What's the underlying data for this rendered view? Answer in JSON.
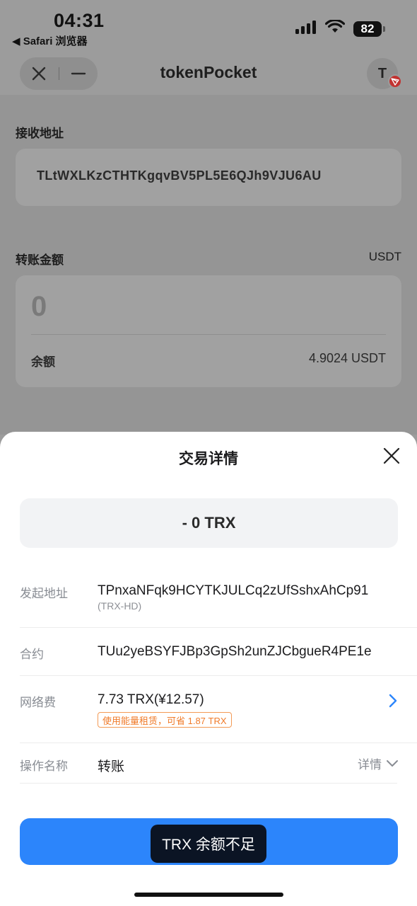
{
  "status_bar": {
    "time": "04:31",
    "back_app": "◀ Safari 浏览器",
    "battery": "82"
  },
  "nav": {
    "title": "tokenPocket",
    "avatar_letter": "T"
  },
  "form": {
    "receive_label": "接收地址",
    "receive_address": "TLtWXLKzCTHTKgqvBV5PL5E6QJh9VJU6AU",
    "amount_label": "转账金额",
    "amount_unit": "USDT",
    "amount_value": "0",
    "balance_label": "余额",
    "balance_value": "4.9024 USDT"
  },
  "sheet": {
    "title": "交易详情",
    "amount": "- 0 TRX",
    "from_label": "发起地址",
    "from_address": "TPnxaNFqk9HCYTKJULCq2zUfSshxAhCp91",
    "from_sub": "(TRX-HD)",
    "contract_label": "合约",
    "contract_address": "TUu2yeBSYFJBp3GpSh2unZJCbgueR4PE1e",
    "fee_label": "网络费",
    "fee_value": "7.73 TRX(¥12.57)",
    "fee_tip": "使用能量租赁，可省 1.87 TRX",
    "op_label": "操作名称",
    "op_value": "转账",
    "details_label": "详情",
    "toast": "TRX 余额不足"
  },
  "colors": {
    "accent": "#2c85fb",
    "warning": "#f07b2a",
    "tron_red": "#c23230"
  }
}
